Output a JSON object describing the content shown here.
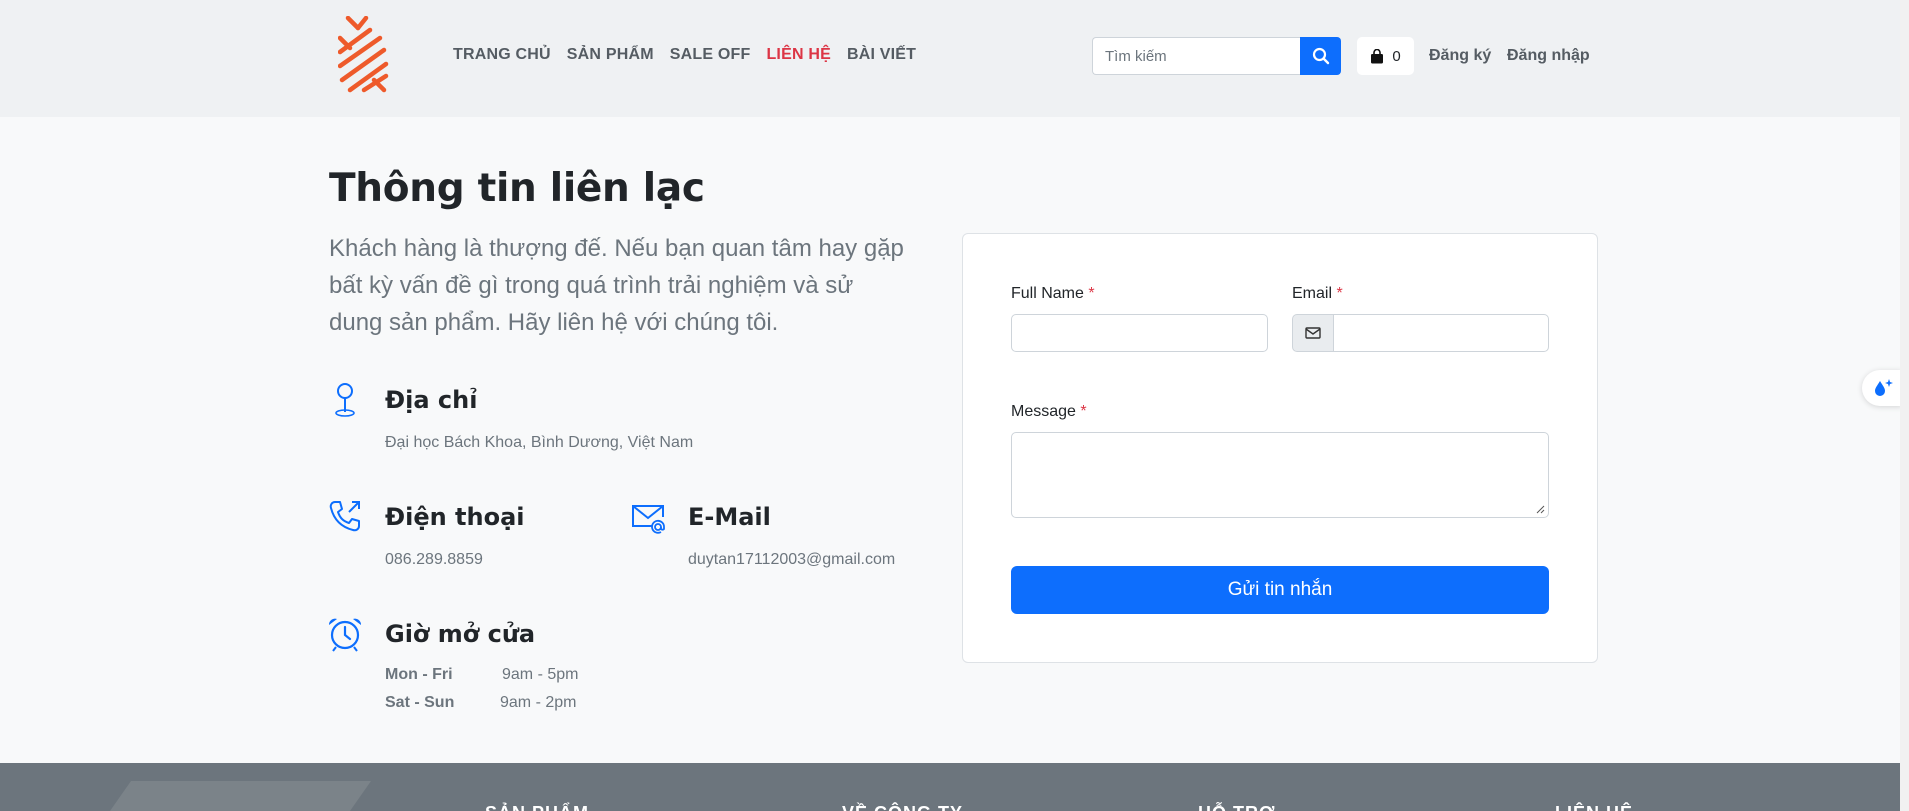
{
  "header": {
    "nav": [
      {
        "label": "TRANG CHỦ"
      },
      {
        "label": "SẢN PHẨM"
      },
      {
        "label": "SALE OFF"
      },
      {
        "label": "LIÊN HỆ",
        "active": true
      },
      {
        "label": "BÀI VIẾT"
      }
    ],
    "search": {
      "placeholder": "Tìm kiếm",
      "icon": "search-icon"
    },
    "cart": {
      "count": "0",
      "icon": "shopping-bag-icon"
    },
    "register_label": "Đăng ký",
    "login_label": "Đăng nhập",
    "logo_color": "#ee5a2b"
  },
  "contact": {
    "title": "Thông tin liên lạc",
    "lead": "Khách hàng là thượng đế. Nếu bạn quan tâm hay gặp bất kỳ vấn đề gì trong quá trình trải nghiệm và sử dung sản phẩm. Hãy liên hệ với chúng tôi.",
    "address": {
      "title": "Địa chỉ",
      "value": "Đại học Bách Khoa, Bình Dương, Việt Nam",
      "icon": "map-pin-icon"
    },
    "phone": {
      "title": "Điện thoại",
      "value": "086.289.8859",
      "icon": "phone-icon"
    },
    "email": {
      "title": "E-Mail",
      "value": "duytan17112003@gmail.com",
      "icon": "envelope-at-icon"
    },
    "hours": {
      "title": "Giờ mở cửa",
      "icon": "alarm-clock-icon",
      "rows": [
        {
          "day": "Mon - Fri",
          "time": "9am - 5pm"
        },
        {
          "day": "Sat - Sun",
          "time": "9am - 2pm"
        }
      ]
    }
  },
  "form": {
    "full_name_label": "Full Name",
    "email_label": "Email",
    "message_label": "Message",
    "required_mark": "*",
    "submit_label": "Gửi tin nhắn",
    "email_prefix_icon": "envelope-icon"
  },
  "footer": {
    "headings": [
      "SẢN PHẨM",
      "VỀ CÔNG TY",
      "HỖ TRỢ",
      "LIÊN HỆ"
    ]
  },
  "colors": {
    "accent": "#0d6efd",
    "active_nav": "#dc3545",
    "header_bg": "#eff1f3",
    "footer_bg": "#6c757d"
  }
}
